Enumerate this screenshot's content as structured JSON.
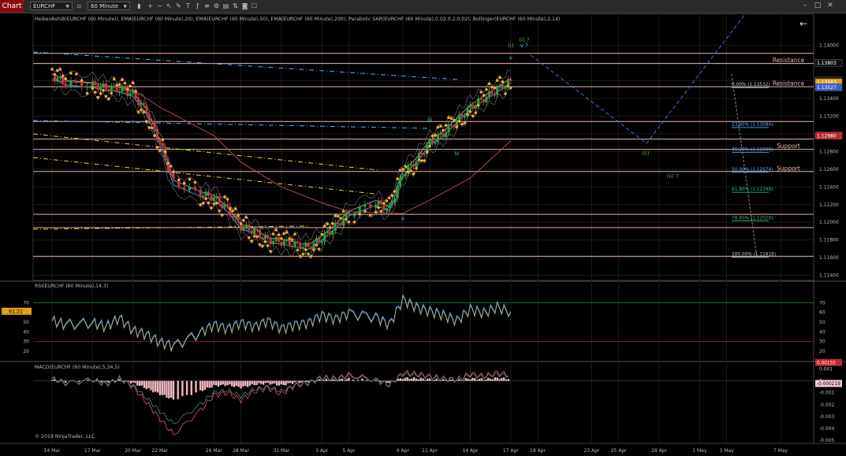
{
  "toolbar": {
    "tab_label": "Chart",
    "instrument": "EURCHF",
    "period": "60 Minute"
  },
  "indicator_caption": "HeikenAshi8(EURCHF (60 Minute)), EMA(EURCHF (60 Minute),20), EMA(EURCHF (60 Minute),50), EMA(EURCHF (60 Minute),200), Parabolic SAR(EURCHF (60 Minute),0.02,0.2,0.02), Bollinger(EURCHF (60 Minute),2,14)",
  "copyright": "© 2019 NinjaTrader, LLC",
  "colors": {
    "background": "#000000",
    "horizontal_levels": "#e7b3b3",
    "fib_text": "#cccccc",
    "fib_highlight": "#5aa8ff",
    "fib_green": "#3fbf7f",
    "wave_green": "#3fbf3f",
    "wave_cyan": "#35c8e0",
    "sar_orange": "#f2a531",
    "ema_blue": "#4a8fe0",
    "ema_red": "#b04a4a",
    "projection_blue": "#3a6fd8"
  },
  "chart_data": [
    {
      "type": "candlestick",
      "title": "",
      "x_tick_labels": [
        "14 Mar",
        "17 Mar",
        "20 Mar",
        "22 Mar",
        "26 Mar",
        "28 Mar",
        "31 Mar",
        "3 Apr",
        "5 Apr",
        "9 Apr",
        "11 Apr",
        "14 Apr",
        "17 Apr",
        "19 Apr",
        "23 Apr",
        "25 Apr",
        "28 Apr",
        "1 May",
        "3 May",
        "7 May"
      ],
      "y_tick_labels": [
        "1.14000",
        "1.13800",
        "1.13600",
        "1.13400",
        "1.13200",
        "1.13000",
        "1.12800",
        "1.12600",
        "1.12400",
        "1.12200",
        "1.12000",
        "1.11800",
        "1.11600",
        "1.11400"
      ],
      "y_range": [
        1.1137,
        1.1413
      ],
      "price_path": {
        "x": [
          "14 Mar",
          "15 Mar",
          "17 Mar",
          "18 Mar",
          "19 Mar",
          "20 Mar",
          "21 Mar",
          "22 Mar",
          "23 Mar",
          "25 Mar",
          "26 Mar",
          "27 Mar",
          "28 Mar",
          "29 Mar",
          "30 Mar",
          "31 Mar",
          "1 Apr",
          "2 Apr",
          "3 Apr",
          "4 Apr",
          "5 Apr",
          "7 Apr",
          "8 Apr",
          "9 Apr",
          "10 Apr",
          "11 Apr",
          "12 Apr",
          "13 Apr",
          "14 Apr",
          "15 Apr",
          "16 Apr",
          "17 Apr"
        ],
        "close": [
          1.1365,
          1.1358,
          1.1355,
          1.1352,
          1.135,
          1.1345,
          1.1325,
          1.129,
          1.1245,
          1.1232,
          1.1228,
          1.1215,
          1.1195,
          1.119,
          1.118,
          1.1178,
          1.1175,
          1.1172,
          1.1182,
          1.1195,
          1.121,
          1.1222,
          1.1215,
          1.1255,
          1.127,
          1.129,
          1.13,
          1.1315,
          1.133,
          1.134,
          1.135,
          1.136
        ]
      },
      "ema_200": {
        "x": [
          "14 Mar",
          "17 Mar",
          "20 Mar",
          "22 Mar",
          "26 Mar",
          "28 Mar",
          "31 Mar",
          "3 Apr",
          "5 Apr",
          "9 Apr",
          "11 Apr",
          "14 Apr",
          "17 Apr"
        ],
        "y": [
          1.136,
          1.1357,
          1.135,
          1.133,
          1.1298,
          1.1268,
          1.124,
          1.1222,
          1.1212,
          1.121,
          1.1225,
          1.125,
          1.1292
        ]
      },
      "price_markers": [
        {
          "label": "1.13803",
          "value": 1.13803
        },
        {
          "label": "1.13603",
          "value": 1.13603
        },
        {
          "label": "1.13583",
          "value": 1.13583
        },
        {
          "label": "1.13527",
          "value": 1.13527
        },
        {
          "label": "1.12980",
          "value": 1.1298
        }
      ],
      "horizontal_levels": [
        {
          "value": 1.1391,
          "label": ""
        },
        {
          "value": 1.13795,
          "label": "Resistance"
        },
        {
          "value": 1.13532,
          "label": "Resistance"
        },
        {
          "value": 1.1314,
          "label": ""
        },
        {
          "value": 1.1294,
          "label": ""
        },
        {
          "value": 1.12825,
          "label": "Support"
        },
        {
          "value": 1.12574,
          "label": "Support"
        },
        {
          "value": 1.1209,
          "label": ""
        },
        {
          "value": 1.1194,
          "label": ""
        },
        {
          "value": 1.11616,
          "label": ""
        }
      ],
      "fib_retracement": [
        {
          "label": "0.00% (1.13532)",
          "value": 1.13532
        },
        {
          "label": "23.60% (1.13080)",
          "value": 1.1308
        },
        {
          "label": "38.20% (1.12800)",
          "value": 1.128
        },
        {
          "label": "50.00% (1.12574)",
          "value": 1.12574
        },
        {
          "label": "61.80% (1.12348)",
          "value": 1.12348
        },
        {
          "label": "78.60% (1.12026)",
          "value": 1.12026
        },
        {
          "label": "100.00% (1.11616)",
          "value": 1.11616
        }
      ],
      "wave_labels": [
        {
          "text": "(i)",
          "x": "17 Apr",
          "y": 1.1398
        },
        {
          "text": "(i) ?",
          "x": "18 Apr",
          "y": 1.1404
        },
        {
          "text": "v ?",
          "x": "18 Apr",
          "y": 1.1398
        },
        {
          "text": "v",
          "x": "17 Apr",
          "y": 1.1384
        },
        {
          "text": "(ii)",
          "x": "27 Apr",
          "y": 1.1276
        },
        {
          "text": "(ii) ?",
          "x": "29 Apr",
          "y": 1.125
        },
        {
          "text": "iii",
          "x": "11 Apr",
          "y": 1.1314
        },
        {
          "text": "iv",
          "x": "13 Apr",
          "y": 1.1276
        },
        {
          "text": "ii",
          "x": "9 Apr",
          "y": 1.1202
        },
        {
          "text": "(c)",
          "x": "2 Apr",
          "y": 1.1163
        }
      ]
    },
    {
      "type": "line",
      "title": "RSI(EURCHF (60 Minute),14,3)",
      "y_tick_labels": [
        "70",
        "60",
        "50",
        "40",
        "30",
        "20"
      ],
      "y_range": [
        15,
        85
      ],
      "levels": [
        70,
        30
      ],
      "current_value_label": "61.21",
      "current_value": 61.21,
      "series": [
        {
          "x": [
            "14 Mar",
            "15 Mar",
            "17 Mar",
            "18 Mar",
            "19 Mar",
            "20 Mar",
            "21 Mar",
            "22 Mar",
            "23 Mar",
            "25 Mar",
            "26 Mar",
            "27 Mar",
            "28 Mar",
            "29 Mar",
            "30 Mar",
            "31 Mar",
            "1 Apr",
            "2 Apr",
            "3 Apr",
            "4 Apr",
            "5 Apr",
            "7 Apr",
            "8 Apr",
            "9 Apr",
            "10 Apr",
            "11 Apr",
            "12 Apr",
            "13 Apr",
            "14 Apr",
            "15 Apr",
            "16 Apr",
            "17 Apr"
          ],
          "values": [
            52,
            48,
            50,
            46,
            55,
            42,
            38,
            30,
            26,
            40,
            48,
            44,
            50,
            46,
            52,
            44,
            48,
            50,
            58,
            54,
            60,
            56,
            48,
            74,
            66,
            62,
            58,
            52,
            64,
            60,
            66,
            61
          ]
        }
      ]
    },
    {
      "type": "line",
      "title": "MACD(EURCHF (60 Minute),5,34,5)",
      "y_tick_labels": [
        "0.001",
        "0",
        "-0.001",
        "-0.002",
        "-0.003",
        "-0.004",
        "-0.005"
      ],
      "y_range": [
        -0.0052,
        0.0013
      ],
      "price_markers": [
        {
          "label": "0.00155",
          "value": 0.00155
        },
        {
          "label": "-0.000219",
          "value": -0.000219
        }
      ],
      "series": [
        {
          "name": "",
          "x": [
            "14 Mar",
            "15 Mar",
            "17 Mar",
            "18 Mar",
            "19 Mar",
            "20 Mar",
            "21 Mar",
            "22 Mar",
            "23 Mar",
            "25 Mar",
            "26 Mar",
            "27 Mar",
            "28 Mar",
            "29 Mar",
            "30 Mar",
            "31 Mar",
            "1 Apr",
            "2 Apr",
            "3 Apr",
            "4 Apr",
            "5 Apr",
            "7 Apr",
            "8 Apr",
            "9 Apr",
            "10 Apr",
            "11 Apr",
            "12 Apr",
            "13 Apr",
            "14 Apr",
            "15 Apr",
            "16 Apr",
            "17 Apr"
          ],
          "values": [
            0.0002,
            -0.0002,
            0.0001,
            -0.0003,
            0.0002,
            -0.0005,
            -0.0018,
            -0.0032,
            -0.0045,
            -0.0025,
            -0.0012,
            -0.001,
            -0.0016,
            -0.0009,
            -0.0006,
            -0.0011,
            -0.0004,
            -0.0002,
            0.0003,
            0.0002,
            0.0005,
            0.0001,
            -0.0004,
            0.0007,
            0.0006,
            0.0004,
            0.0002,
            0.0001,
            0.0006,
            0.0004,
            0.0007,
            0.0005
          ]
        }
      ]
    }
  ]
}
